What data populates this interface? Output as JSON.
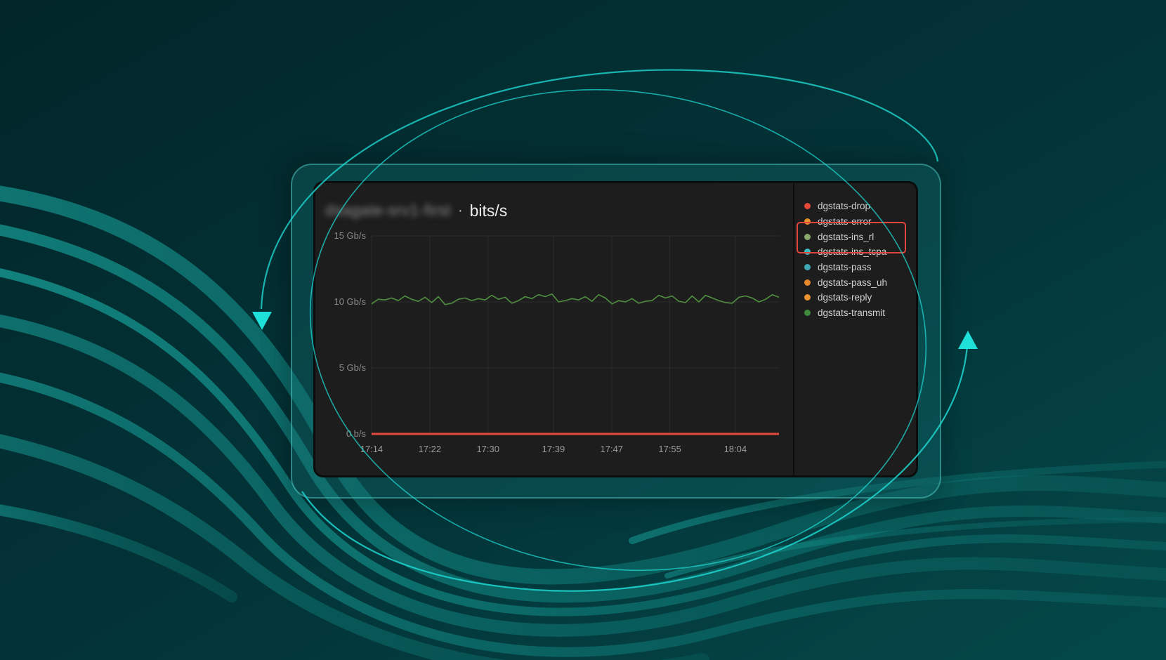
{
  "panel": {
    "source_name": "dsagate-srv1-first",
    "separator": "·",
    "metric": "bits/s"
  },
  "legend": [
    {
      "label": "dgstats-drop",
      "color": "#e5493a"
    },
    {
      "label": "dgstats-error",
      "color": "#e8922f"
    },
    {
      "label": "dgstats-ins_rl",
      "color": "#8aa86b"
    },
    {
      "label": "dgstats-ins_tcpa",
      "color": "#3bbcc4"
    },
    {
      "label": "dgstats-pass",
      "color": "#3fa6b3"
    },
    {
      "label": "dgstats-pass_uh",
      "color": "#e8862a"
    },
    {
      "label": "dgstats-reply",
      "color": "#e8922f"
    },
    {
      "label": "dgstats-transmit",
      "color": "#3f8a3c"
    }
  ],
  "highlighted_legend": [
    "dgstats-ins_rl",
    "dgstats-ins_tcpa"
  ],
  "chart_data": {
    "type": "line",
    "title": "bits/s",
    "ylim": [
      0,
      15
    ],
    "yticks": [
      {
        "value": 15,
        "label": "15 Gb/s"
      },
      {
        "value": 10,
        "label": "10 Gb/s"
      },
      {
        "value": 5,
        "label": "5 Gb/s"
      },
      {
        "value": 0,
        "label": "0 b/s"
      }
    ],
    "xlim": [
      "17:14",
      "18:10"
    ],
    "xticks": [
      "17:14",
      "17:22",
      "17:30",
      "17:39",
      "17:47",
      "17:55",
      "18:04"
    ],
    "grid": true,
    "series": [
      {
        "name": "dgstats-transmit",
        "color": "#4f8f3f",
        "values": [
          9.85,
          10.2,
          10.15,
          10.3,
          10.1,
          10.45,
          10.2,
          10.05,
          10.35,
          9.95,
          10.4,
          9.8,
          9.9,
          10.2,
          10.3,
          10.1,
          10.25,
          10.15,
          10.5,
          10.2,
          10.35,
          9.9,
          10.1,
          10.4,
          10.25,
          10.55,
          10.4,
          10.6,
          10.0,
          10.1,
          10.25,
          10.15,
          10.4,
          10.05,
          10.55,
          10.3,
          9.85,
          10.1,
          10.0,
          10.25,
          9.9,
          10.05,
          10.1,
          10.5,
          10.3,
          10.45,
          10.05,
          9.95,
          10.45,
          10.0,
          10.5,
          10.3,
          10.1,
          9.95,
          9.9,
          10.35,
          10.45,
          10.3,
          10.0,
          10.2,
          10.55,
          10.35
        ]
      },
      {
        "name": "dgstats-drop",
        "color": "#e5493a",
        "values": [
          0,
          0
        ]
      }
    ]
  }
}
